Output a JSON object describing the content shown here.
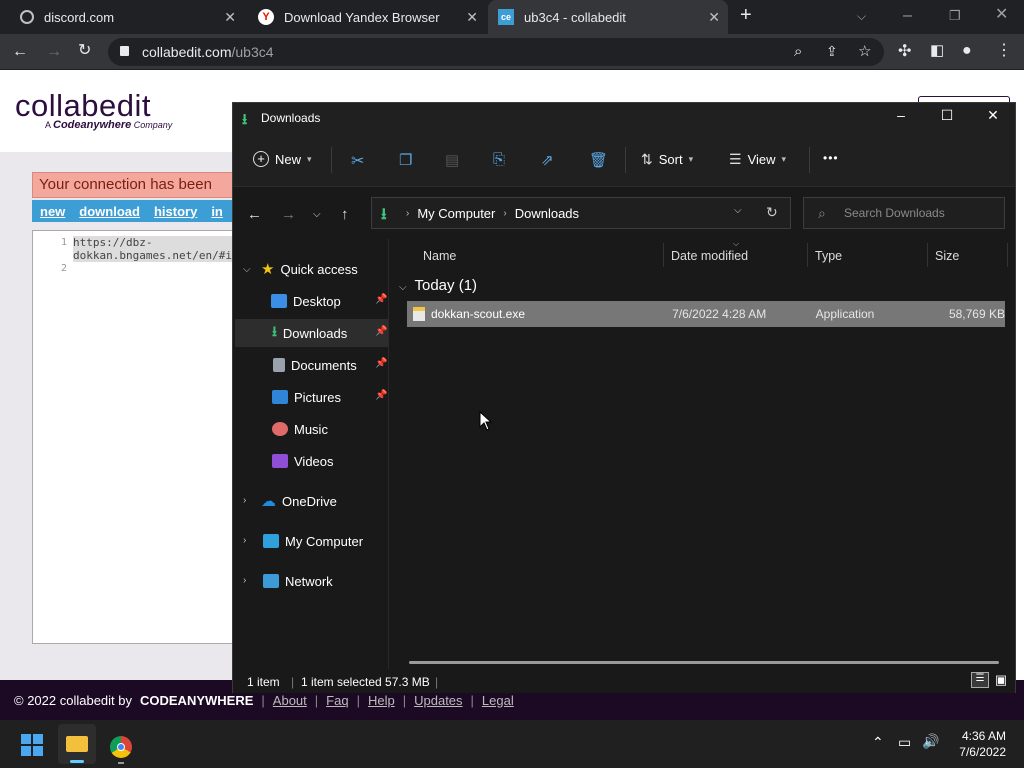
{
  "browser": {
    "tabs": [
      {
        "title": "discord.com",
        "active": false
      },
      {
        "title": "Download Yandex Browser",
        "active": false
      },
      {
        "title": "ub3c4 - collabedit",
        "active": true
      }
    ],
    "tab_close": "✕",
    "new_tab": "+",
    "url_host": "collabedit.com",
    "url_path": "/ub3c4"
  },
  "collabedit": {
    "logo": "collabedit",
    "logo_sub_prefix": "A ",
    "logo_sub_brand": "Codeanywhere",
    "logo_sub_suffix": " Company",
    "warning": "Your connection has been",
    "links": [
      "new",
      "download",
      "history",
      "in"
    ],
    "line_numbers": [
      "1",
      "2"
    ],
    "code": "https://dbz-\ndokkan.bngames.net/en/#i",
    "footer": {
      "copyright": "© 2022 collabedit by",
      "brand": "CODEANYWHERE",
      "links": [
        "About",
        "Faq",
        "Help",
        "Updates",
        "Legal"
      ]
    }
  },
  "explorer": {
    "title": "Downloads",
    "toolbar": {
      "new": "New",
      "sort": "Sort",
      "view": "View",
      "more": "•••"
    },
    "breadcrumb": [
      "My Computer",
      "Downloads"
    ],
    "search_placeholder": "Search Downloads",
    "sidebar": {
      "quick_access": "Quick access",
      "items": [
        {
          "label": "Desktop",
          "pinned": true
        },
        {
          "label": "Downloads",
          "pinned": true
        },
        {
          "label": "Documents",
          "pinned": true
        },
        {
          "label": "Pictures",
          "pinned": true
        },
        {
          "label": "Music",
          "pinned": false
        },
        {
          "label": "Videos",
          "pinned": false
        }
      ],
      "roots": [
        "OneDrive",
        "My Computer",
        "Network"
      ]
    },
    "columns": [
      "Name",
      "Date modified",
      "Type",
      "Size"
    ],
    "group": "Today (1)",
    "files": [
      {
        "name": "dokkan-scout.exe",
        "date": "7/6/2022 4:28 AM",
        "type": "Application",
        "size": "58,769 KB"
      }
    ],
    "status": {
      "count": "1 item",
      "selected": "1 item selected  57.3 MB"
    }
  },
  "taskbar": {
    "time": "4:36 AM",
    "date": "7/6/2022"
  }
}
